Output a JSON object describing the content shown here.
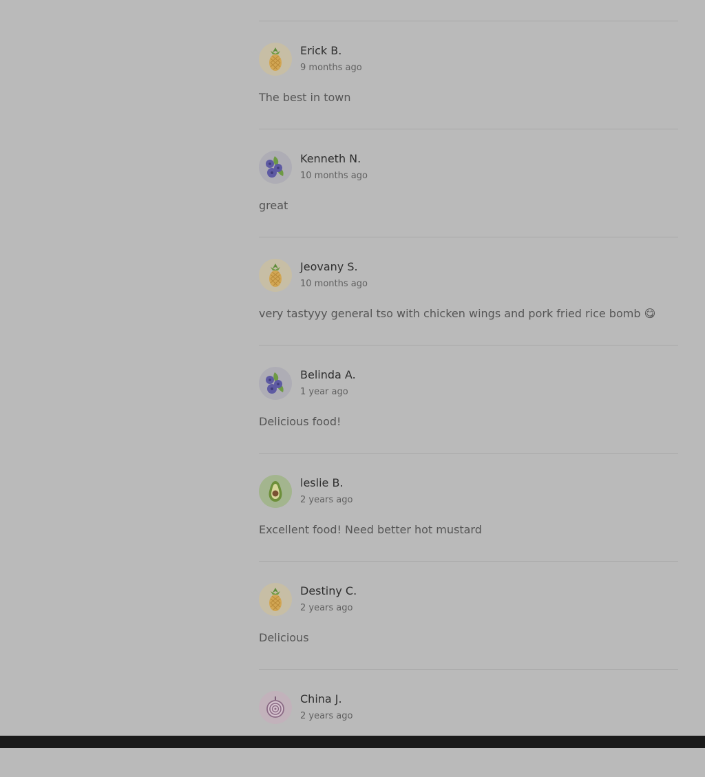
{
  "reviews": [
    {
      "name": "Erick B.",
      "date": "9 months ago",
      "text": "The best in town",
      "avatar_icon": "pineapple-icon",
      "avatar_bg": "#c7bea5"
    },
    {
      "name": "Kenneth N.",
      "date": "10 months ago",
      "text": "great",
      "avatar_icon": "blueberries-icon",
      "avatar_bg": "#aeadb5"
    },
    {
      "name": "Jeovany S.",
      "date": "10 months ago",
      "text": "very tastyyy general tso with chicken wings and pork fried rice bomb 😋",
      "avatar_icon": "pineapple-icon",
      "avatar_bg": "#c7bea5"
    },
    {
      "name": "Belinda A.",
      "date": "1 year ago",
      "text": "Delicious food!",
      "avatar_icon": "blueberries-icon",
      "avatar_bg": "#aeadb5"
    },
    {
      "name": "leslie B.",
      "date": "2 years ago",
      "text": "Excellent food! Need better hot mustard",
      "avatar_icon": "avocado-icon",
      "avatar_bg": "#a3b58e"
    },
    {
      "name": "Destiny C.",
      "date": "2 years ago",
      "text": "Delicious",
      "avatar_icon": "pineapple-icon",
      "avatar_bg": "#c7bea5"
    },
    {
      "name": "China J.",
      "date": "2 years ago",
      "text": "",
      "avatar_icon": "onion-icon",
      "avatar_bg": "#c2b2bb"
    }
  ]
}
